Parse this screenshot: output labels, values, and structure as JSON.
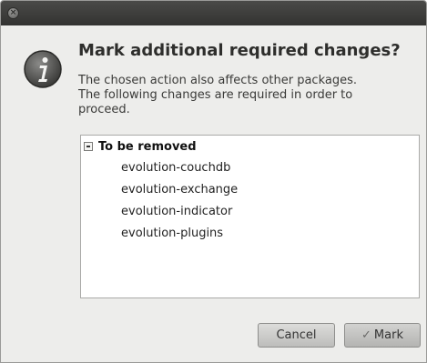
{
  "titlebar": {
    "close_icon": "close-icon"
  },
  "dialog": {
    "icon": "info-icon",
    "heading": "Mark additional required changes?",
    "message_lines": [
      "The chosen action also affects other packages.",
      "The following changes are required in order to",
      "proceed."
    ]
  },
  "tree": {
    "group_label": "To be removed",
    "expander_icon": "collapse-minus-icon",
    "packages": [
      "evolution-couchdb",
      "evolution-exchange",
      "evolution-indicator",
      "evolution-plugins"
    ]
  },
  "buttons": {
    "cancel_label": "Cancel",
    "mark_label": "Mark",
    "mark_icon": "checkmark-icon"
  }
}
